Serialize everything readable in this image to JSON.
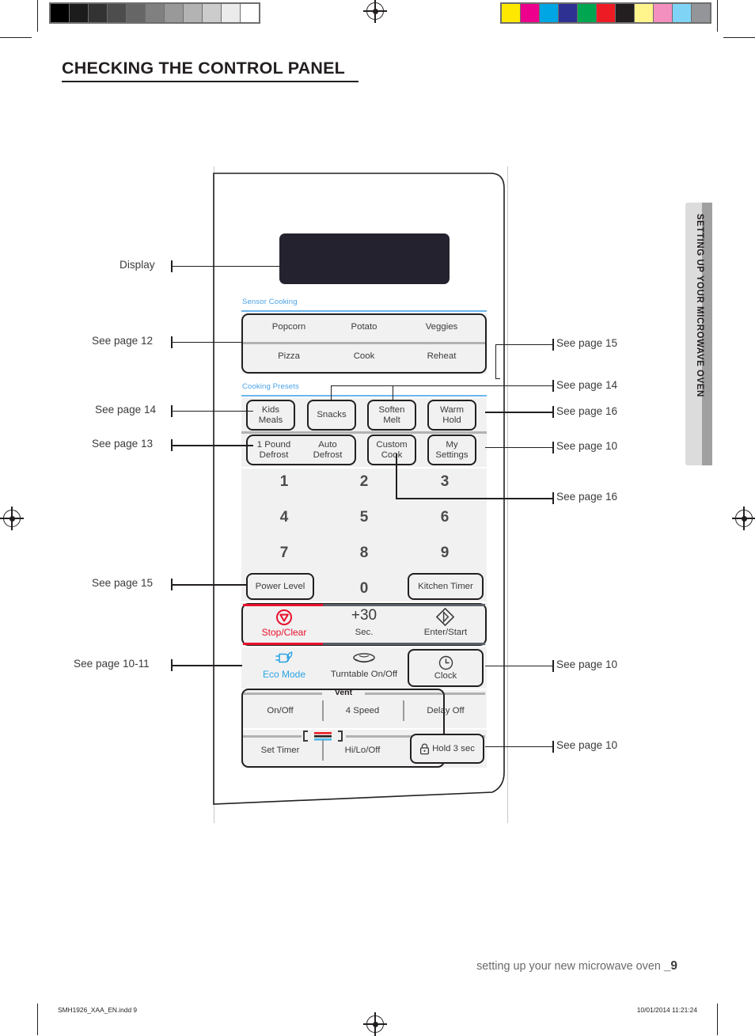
{
  "page": {
    "title": "CHECKING THE CONTROL PANEL",
    "side_tab": "SETTING UP YOUR MICROWAVE OVEN",
    "footer_text": "setting up your new microwave oven",
    "footer_page": "_9",
    "imprint_file": "SMH1926_XAA_EN.indd   9",
    "imprint_date": "10/01/2014   11:21:24"
  },
  "colors": {
    "accent_blue": "#4da3e8",
    "rule_blue": "#6cb6ef",
    "alert_red": "#e8112d",
    "display": "#24222f",
    "panel_fill": "#f1f1f1",
    "separator": "#b2b2b2"
  },
  "panel": {
    "display_label": "Display",
    "sensor_group_label": "Sensor Cooking",
    "sensor_keys_row1": [
      "Popcorn",
      "Potato",
      "Veggies"
    ],
    "sensor_keys_row2": [
      "Pizza",
      "Cook",
      "Reheat"
    ],
    "presets_group_label": "Cooking Presets",
    "preset_keys_row1": [
      {
        "line1": "Kids",
        "line2": "Meals"
      },
      {
        "line1": "Snacks",
        "line2": ""
      },
      {
        "line1": "Soften",
        "line2": "Melt"
      },
      {
        "line1": "Warm",
        "line2": "Hold"
      }
    ],
    "defrost_left": {
      "line1": "1 Pound",
      "line2": "Defrost"
    },
    "defrost_right": {
      "line1": "Auto",
      "line2": "Defrost"
    },
    "preset_keys_row2": [
      {
        "line1": "Custom",
        "line2": "Cook"
      },
      {
        "line1": "My",
        "line2": "Settings"
      }
    ],
    "keypad": [
      "1",
      "2",
      "3",
      "4",
      "5",
      "6",
      "7",
      "8",
      "9",
      "0"
    ],
    "power_level": "Power Level",
    "kitchen_timer": "Kitchen Timer",
    "stop_clear": "Stop/Clear",
    "plus30_main": "+30",
    "plus30_sub": "Sec.",
    "enter_start": "Enter/Start",
    "eco_mode": "Eco Mode",
    "turntable": "Turntable On/Off",
    "clock": "Clock",
    "vent_label": "Vent",
    "vent_keys": [
      "On/Off",
      "4 Speed",
      "Delay Off"
    ],
    "light_keys": [
      "Set Timer",
      "Hi/Lo/Off"
    ],
    "hold_3_sec": "Hold 3 sec",
    "icons": {
      "stop": "stop-octagon-icon",
      "start": "diamond-play-icon",
      "eco": "plug-leaf-icon",
      "turntable": "turntable-icon",
      "clock": "clock-icon",
      "light": "led-light-icon",
      "lock": "padlock-icon"
    }
  },
  "callouts": {
    "left": [
      {
        "text": "Display"
      },
      {
        "text": "See page 12"
      },
      {
        "text": "See page 14"
      },
      {
        "text": "See page 13"
      },
      {
        "text": "See page 15"
      },
      {
        "text": "See page 10-11"
      }
    ],
    "right": [
      {
        "text": "See page 15"
      },
      {
        "text": "See page 14"
      },
      {
        "text": "See page 16"
      },
      {
        "text": "See page 10"
      },
      {
        "text": "See page 16"
      },
      {
        "text": "See page 10"
      },
      {
        "text": "See page 10"
      }
    ]
  },
  "registration": {
    "gray_ramp": [
      "#000000",
      "#1c1c1c",
      "#333333",
      "#4d4d4d",
      "#666666",
      "#808080",
      "#999999",
      "#b3b3b3",
      "#cccccc",
      "#ebebeb",
      "#ffffff"
    ],
    "color_bars": [
      "#ffe800",
      "#ec008c",
      "#00a5e3",
      "#2e3192",
      "#00a650",
      "#ed1c24",
      "#231f20",
      "#fff58c",
      "#f490c0",
      "#7fd4f5",
      "#939598"
    ]
  }
}
